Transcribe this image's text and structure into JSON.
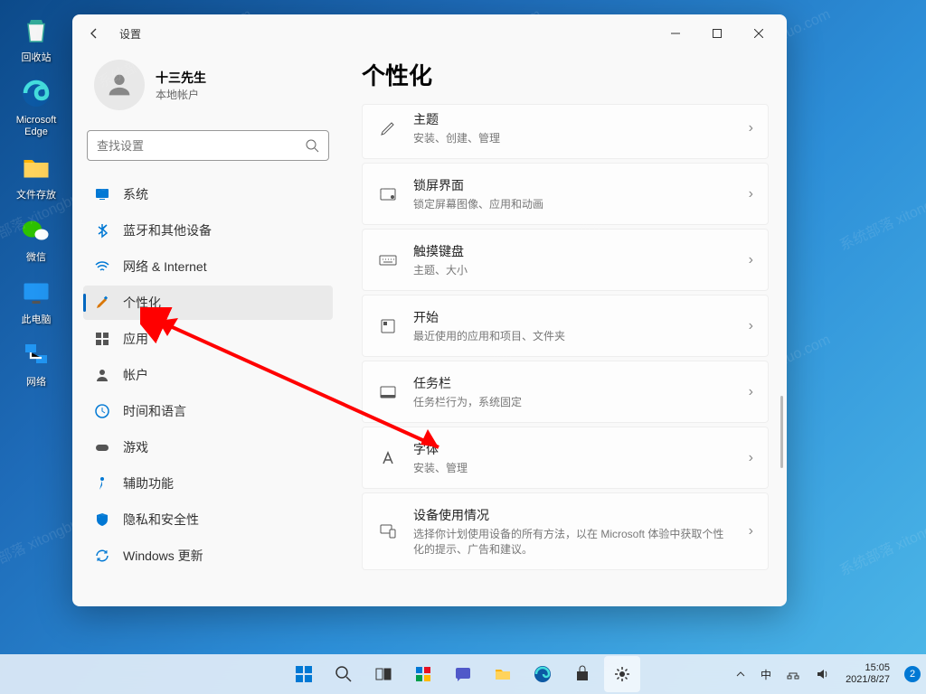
{
  "desktop": {
    "icons": [
      {
        "label": "回收站"
      },
      {
        "label": "Microsoft Edge"
      },
      {
        "label": "文件存放"
      },
      {
        "label": "微信"
      },
      {
        "label": "此电脑"
      },
      {
        "label": "网络"
      }
    ]
  },
  "window": {
    "title": "设置",
    "user": {
      "name": "十三先生",
      "sub": "本地帐户"
    },
    "search_placeholder": "查找设置",
    "nav": [
      {
        "label": "系统"
      },
      {
        "label": "蓝牙和其他设备"
      },
      {
        "label": "网络 & Internet"
      },
      {
        "label": "个性化",
        "selected": true
      },
      {
        "label": "应用"
      },
      {
        "label": "帐户"
      },
      {
        "label": "时间和语言"
      },
      {
        "label": "游戏"
      },
      {
        "label": "辅助功能"
      },
      {
        "label": "隐私和安全性"
      },
      {
        "label": "Windows 更新"
      }
    ],
    "page_title": "个性化",
    "cards": [
      {
        "title": "主题",
        "sub": "安装、创建、管理"
      },
      {
        "title": "锁屏界面",
        "sub": "锁定屏幕图像、应用和动画"
      },
      {
        "title": "触摸键盘",
        "sub": "主题、大小"
      },
      {
        "title": "开始",
        "sub": "最近使用的应用和项目、文件夹"
      },
      {
        "title": "任务栏",
        "sub": "任务栏行为，系统固定"
      },
      {
        "title": "字体",
        "sub": "安装、管理"
      },
      {
        "title": "设备使用情况",
        "sub": "选择你计划使用设备的所有方法，以在 Microsoft 体验中获取个性化的提示、广告和建议。"
      }
    ]
  },
  "taskbar": {
    "ime": "中",
    "time": "15:05",
    "date": "2021/8/27",
    "notif_count": "2"
  },
  "watermark": "系统部落 xitongbuluo.com"
}
